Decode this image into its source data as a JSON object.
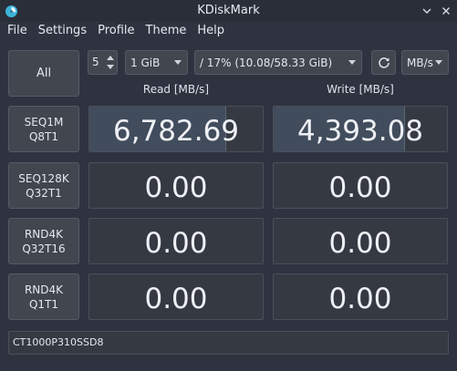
{
  "window": {
    "title": "KDiskMark"
  },
  "menu": [
    "File",
    "Settings",
    "Profile",
    "Theme",
    "Help"
  ],
  "toolbar": {
    "all_label": "All",
    "runs": "5",
    "file_size": "1 GiB",
    "storage": "/ 17% (10.08/58.33 GiB)",
    "unit": "MB/s"
  },
  "headers": {
    "read": "Read [MB/s]",
    "write": "Write [MB/s]"
  },
  "tests": [
    {
      "line1": "SEQ1M",
      "line2": "Q8T1",
      "read": "6,782.69",
      "write": "4,393.08",
      "read_fill": 0.79,
      "write_fill": 0.76
    },
    {
      "line1": "SEQ128K",
      "line2": "Q32T1",
      "read": "0.00",
      "write": "0.00",
      "read_fill": 0,
      "write_fill": 0
    },
    {
      "line1": "RND4K",
      "line2": "Q32T16",
      "read": "0.00",
      "write": "0.00",
      "read_fill": 0,
      "write_fill": 0
    },
    {
      "line1": "RND4K",
      "line2": "Q1T1",
      "read": "0.00",
      "write": "0.00",
      "read_fill": 0,
      "write_fill": 0
    }
  ],
  "device": "CT1000P310SSD8"
}
